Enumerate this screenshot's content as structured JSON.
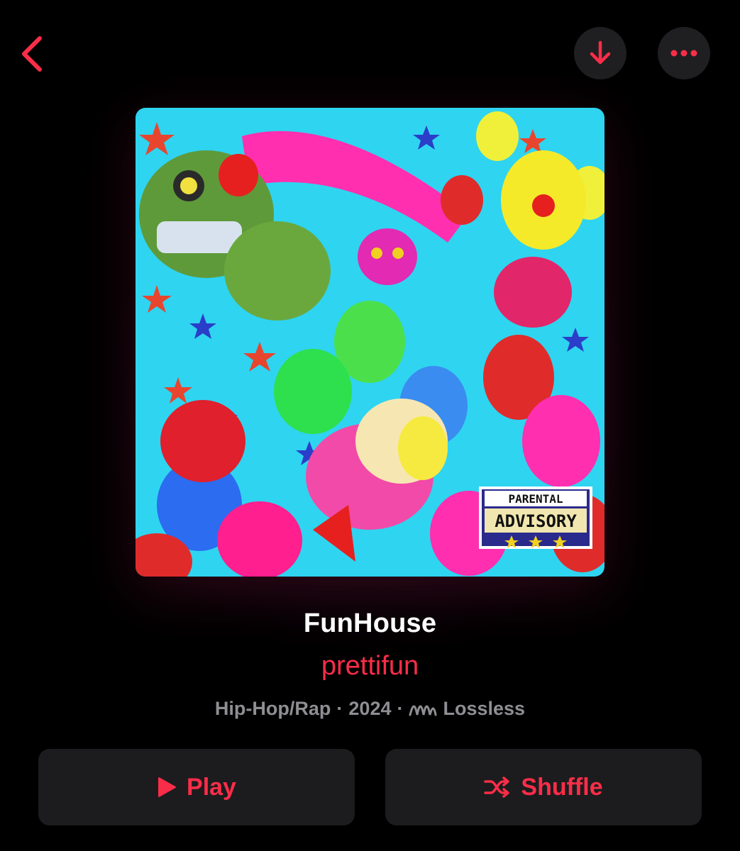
{
  "nav": {
    "back_icon": "chevron-left-icon",
    "download_icon": "arrow-down-icon",
    "more_icon": "ellipsis-icon"
  },
  "album": {
    "title": "FunHouse",
    "artist": "prettifun",
    "genre": "Hip-Hop/Rap",
    "separator": "·",
    "year": "2024",
    "quality": "Lossless",
    "quality_icon": "lossless-wave-icon",
    "artwork_advisory_top": "PARENTAL",
    "artwork_advisory_bottom": "ADVISORY"
  },
  "actions": {
    "play_label": "Play",
    "play_icon": "play-icon",
    "shuffle_label": "Shuffle",
    "shuffle_icon": "shuffle-icon"
  },
  "colors": {
    "accent": "#fa2d48",
    "background": "#000000",
    "button_bg": "#1c1c1e",
    "secondary_text": "#8e8e93",
    "primary_text": "#ffffff"
  }
}
